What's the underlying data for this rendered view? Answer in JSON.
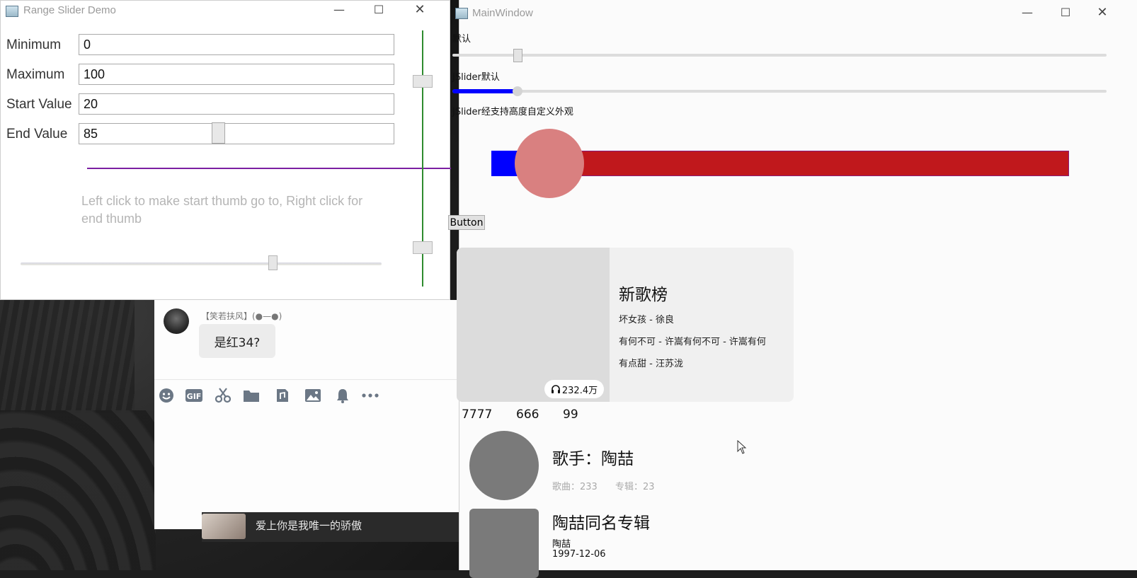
{
  "range_slider_window": {
    "title": "Range Slider Demo",
    "fields": [
      {
        "label": "Minimum",
        "value": "0"
      },
      {
        "label": "Maximum",
        "value": "100"
      },
      {
        "label": "Start Value",
        "value": "20"
      },
      {
        "label": "End Value",
        "value": "85"
      }
    ],
    "hint": "Left click to make start thumb go to, Right click for end thumb",
    "colors": {
      "range_line": "#7b1fa2",
      "vertical_track": "#2e8b2e"
    }
  },
  "chat_window": {
    "user": "【笑若扶风】(●—●)",
    "message": "是红34?",
    "bottom_item_text": "爱上你是我唯一的骄傲",
    "toolbar_icons": [
      "smile-icon",
      "gif-icon",
      "scissors-icon",
      "folder-icon",
      "music-file-icon",
      "image-icon",
      "bell-icon",
      "more-icon"
    ]
  },
  "main_window": {
    "title": "MainWindow",
    "slider_default_label": "默认",
    "jslider_default_label": "JSlider默认",
    "jslider_custom_label": "JSlider经支持高度自定义外观",
    "slider_default_value": 0.1,
    "jslider_default_value": 0.1,
    "custom_slider_value": 0.1,
    "colors": {
      "fill": "#0000ff",
      "track": "#c0181c",
      "thumb": "#d98080"
    },
    "button_label": "Button",
    "card": {
      "title": "新歌榜",
      "songs": [
        "坏女孩 - 徐良",
        "有何不可 - 许嵩有何不可 - 许嵩有何",
        "有点甜 - 汪苏泷"
      ],
      "plays": "232.4万"
    },
    "stats": [
      "7777",
      "666",
      "99"
    ],
    "singer": {
      "name": "歌手：陶喆",
      "songs": "歌曲：233",
      "albums": "专辑：23"
    },
    "album": {
      "name": "陶喆同名专辑",
      "artist": "陶喆",
      "date": "1997-12-06"
    }
  }
}
